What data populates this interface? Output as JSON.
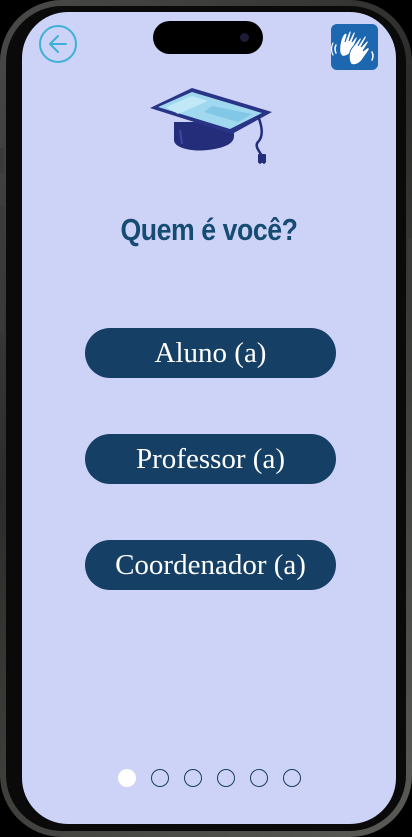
{
  "header": {
    "back_icon": "arrow-left-icon",
    "accessibility_icon": "sign-language-hands-icon"
  },
  "logo": {
    "icon": "graduation-cap-tablet-icon"
  },
  "title": "Quem é você?",
  "roles": [
    {
      "label": "Aluno (a)"
    },
    {
      "label": "Professor (a)"
    },
    {
      "label": "Coordenador (a)"
    }
  ],
  "pagination": {
    "total": 6,
    "current": 1
  },
  "colors": {
    "screen_bg": "#cdd3f7",
    "button_bg": "#153f64",
    "title": "#164b74",
    "back_accent": "#3fb0d6",
    "accessibility_bg": "#1d66b0"
  }
}
